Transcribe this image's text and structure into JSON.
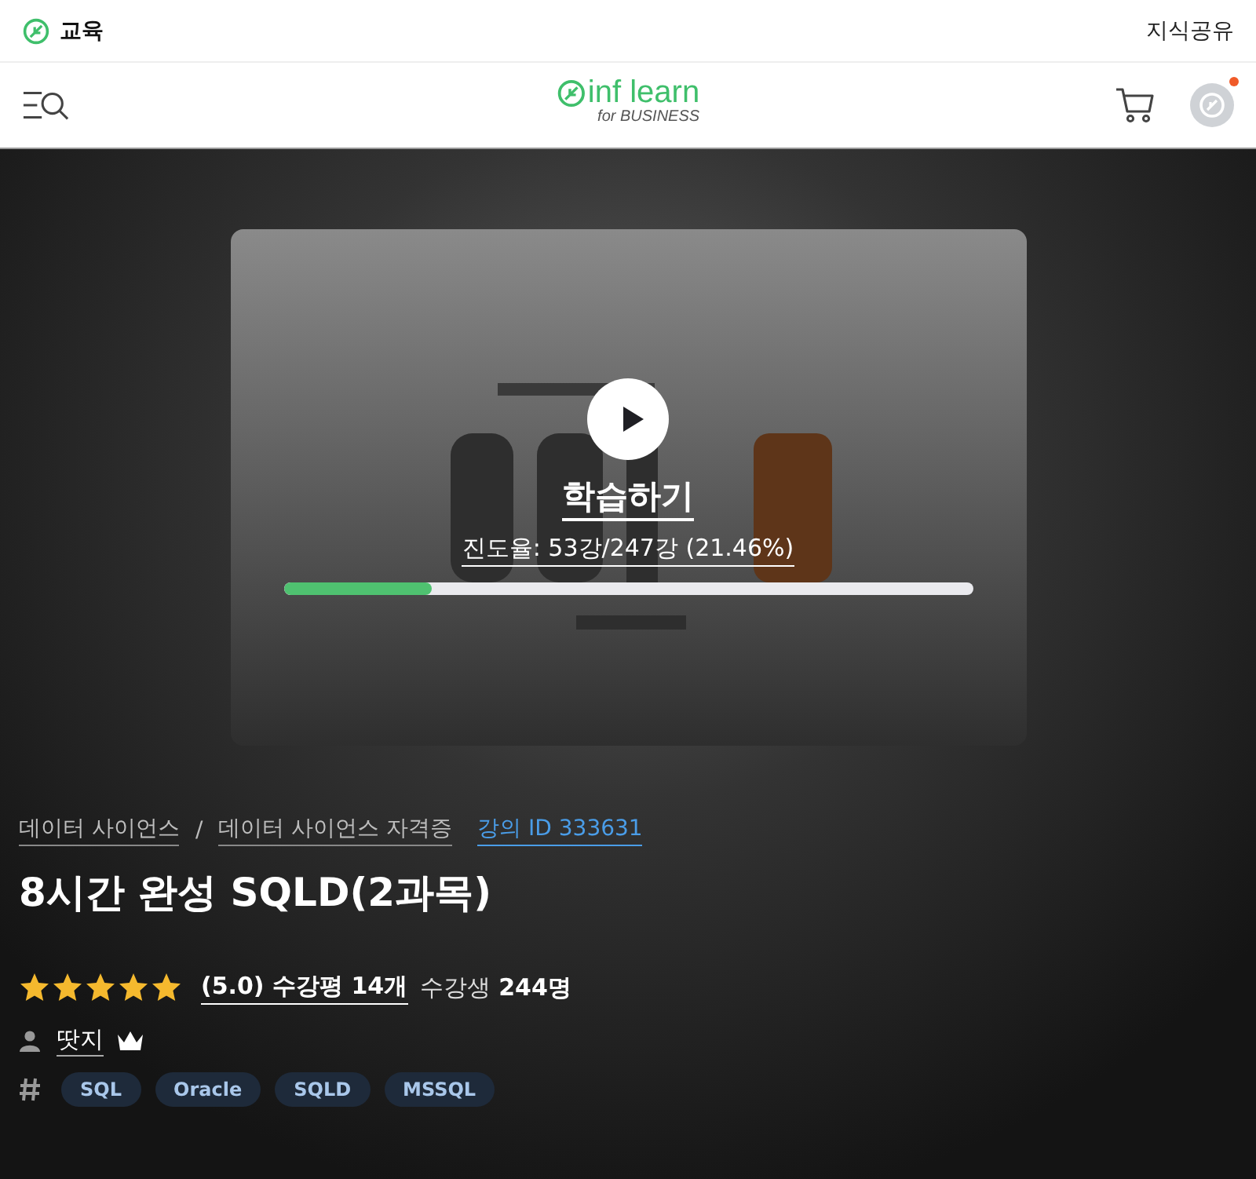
{
  "top_bar": {
    "left_label": "교육",
    "right_link": "지식공유"
  },
  "header": {
    "logo": {
      "name": "inf learn",
      "sub": "for BUSINESS"
    },
    "notification_dot": true
  },
  "course_card": {
    "action": "학습하기",
    "progress_text": "진도율: 53강/247강 (21.46%)",
    "progress": {
      "level": 0.2146
    }
  },
  "breadcrumbs": [
    {
      "label": "데이터 사이언스",
      "kind": "category"
    },
    {
      "label": "/",
      "kind": "separator"
    },
    {
      "label": "데이터 사이언스 자격증",
      "kind": "category"
    },
    {
      "label": "강의 ID 333631",
      "kind": "id"
    }
  ],
  "title": "8시간 완성 SQLD(2과목)",
  "rating": {
    "stars": 5,
    "review_link": "(5.0) 수강평 14개",
    "students_label": "수강생",
    "students_count": "244명"
  },
  "instructor": {
    "name": "땃지",
    "crown": true
  },
  "tags": [
    "SQL",
    "Oracle",
    "SQLD",
    "MSSQL"
  ]
}
